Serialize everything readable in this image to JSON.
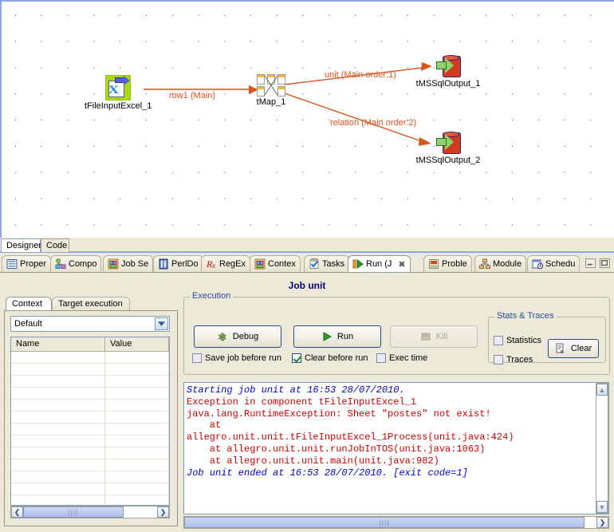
{
  "designer": {
    "nodes": [
      {
        "id": "tFileInputExcel_1",
        "label": "tFileInputExcel_1",
        "icon": "excel-input-icon"
      },
      {
        "id": "tMap_1",
        "label": "tMap_1",
        "icon": "tmap-icon"
      },
      {
        "id": "tMSSqlOutput_1",
        "label": "tMSSqlOutput_1",
        "icon": "database-output-icon"
      },
      {
        "id": "tMSSqlOutput_2",
        "label": "tMSSqlOutput_2",
        "icon": "database-output-icon"
      }
    ],
    "links": [
      {
        "label": "row1 (Main)",
        "from": "tFileInputExcel_1",
        "to": "tMap_1"
      },
      {
        "label": "unit (Main order:1)",
        "from": "tMap_1",
        "to": "tMSSqlOutput_1"
      },
      {
        "label": "relation (Main order:2)",
        "from": "tMap_1",
        "to": "tMSSqlOutput_2"
      }
    ],
    "editor_tabs": [
      {
        "label": "Designer",
        "selected": true
      },
      {
        "label": "Code",
        "selected": false
      }
    ]
  },
  "view_tabs": [
    {
      "label": "Proper",
      "icon": "properties-icon",
      "selected": false
    },
    {
      "label": "Compo",
      "icon": "component-icon",
      "selected": false
    },
    {
      "label": "Job Se",
      "icon": "job-settings-icon",
      "selected": false
    },
    {
      "label": "PerlDo",
      "icon": "perl-doc-icon",
      "selected": false
    },
    {
      "label": "RegEx",
      "icon": "regex-icon",
      "selected": false
    },
    {
      "label": "Contex",
      "icon": "context-icon",
      "selected": false
    },
    {
      "label": "Tasks",
      "icon": "tasks-icon",
      "selected": false
    },
    {
      "label": "Run (J",
      "icon": "run-icon",
      "selected": true,
      "closable": true
    },
    {
      "label": "Proble",
      "icon": "problems-icon",
      "selected": false
    },
    {
      "label": "Module",
      "icon": "modules-icon",
      "selected": false
    },
    {
      "label": "Schedu",
      "icon": "scheduler-icon",
      "selected": false
    }
  ],
  "window_controls": {
    "minimize": "minimize-icon",
    "maximize": "maximize-icon"
  },
  "run_panel": {
    "title": "Job unit",
    "left_tabs": [
      {
        "label": "Context",
        "selected": true
      },
      {
        "label": "Target execution",
        "selected": false
      }
    ],
    "context_combo": {
      "value": "Default",
      "arrow": "chevron-down-icon"
    },
    "context_table": {
      "columns": [
        "Name",
        "Value"
      ],
      "rows": []
    },
    "execution": {
      "legend": "Execution",
      "buttons": [
        {
          "label": "Debug",
          "icon": "debug-bug-icon",
          "enabled": true
        },
        {
          "label": "Run",
          "icon": "run-play-icon",
          "enabled": true
        },
        {
          "label": "Kill",
          "icon": "kill-stop-icon",
          "enabled": false
        }
      ],
      "checkboxes": [
        {
          "label": "Save job before run",
          "checked": false
        },
        {
          "label": "Clear before run",
          "checked": true
        },
        {
          "label": "Exec time",
          "checked": false
        }
      ]
    },
    "stats_traces": {
      "legend": "Stats & Traces",
      "checkboxes": [
        {
          "label": "Statistics",
          "checked": false
        },
        {
          "label": "Traces",
          "checked": false
        }
      ],
      "clear_button": {
        "label": "Clear",
        "icon": "clear-document-icon"
      }
    },
    "console": {
      "lines": [
        {
          "text": "Starting job unit at 16:53 28/07/2010.",
          "style": "italic-blue"
        },
        {
          "text": "Exception in component tFileInputExcel_1",
          "style": "red"
        },
        {
          "text": "java.lang.RuntimeException: Sheet \"postes\" not exist!",
          "style": "red"
        },
        {
          "text": "    at",
          "style": "red"
        },
        {
          "text": "allegro.unit.unit.tFileInputExcel_1Process(unit.java:424)",
          "style": "red"
        },
        {
          "text": "    at allegro.unit.unit.runJobInTOS(unit.java:1063)",
          "style": "red"
        },
        {
          "text": "    at allegro.unit.unit.main(unit.java:982)",
          "style": "red"
        },
        {
          "text": "Job unit ended at 16:53 28/07/2010. [exit code=1]",
          "style": "italic-blue"
        }
      ]
    }
  },
  "scroll": {
    "left_arrow": "chevron-left-icon",
    "right_arrow": "chevron-right-icon",
    "up_arrow": "chevron-up-icon",
    "down_arrow": "chevron-down-icon",
    "grip": "||||"
  },
  "colors": {
    "link": "#d9541d",
    "legend": "#2a4a9a",
    "title": "#000080",
    "error": "#d00000",
    "info": "#0000cc",
    "panel": "#ece9d8"
  }
}
